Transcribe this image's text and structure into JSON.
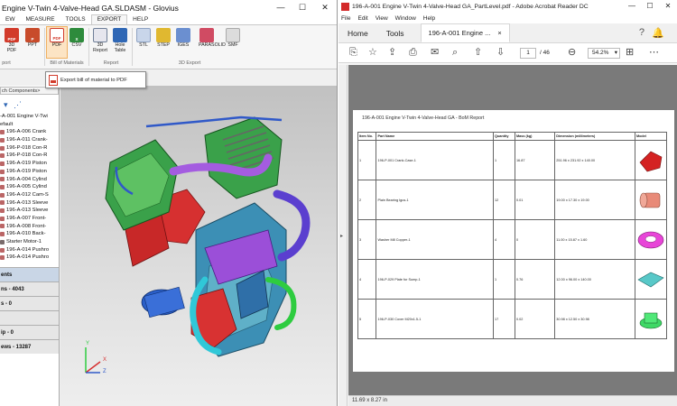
{
  "glovius": {
    "title": "Engine V-Twin 4-Valve-Head GA.SLDASM - Glovius",
    "window_controls": {
      "minimize": "—",
      "maximize": "☐",
      "close": "✕"
    },
    "menu": [
      "EW",
      "MEASURE",
      "TOOLS",
      "EXPORT",
      "HELP"
    ],
    "active_menu": "EXPORT",
    "ribbon": {
      "buttons": [
        {
          "label1": "3D",
          "label2": "PDF",
          "color": "#d23b2b"
        },
        {
          "label1": "PPT",
          "label2": "",
          "color": "#c84b2b"
        },
        {
          "label1": "PDF",
          "label2": "",
          "color": "#d23b2b"
        },
        {
          "label1": "CSV",
          "label2": "",
          "color": "#2e8b3c"
        },
        {
          "label1": "3D",
          "label2": "Report",
          "color": "#6f7f98"
        },
        {
          "label1": "Hole",
          "label2": "Table",
          "color": "#2f67b5"
        },
        {
          "label1": "STL",
          "label2": "",
          "color": "#8fa3c3"
        },
        {
          "label1": "STEP",
          "label2": "",
          "color": "#e0b830"
        },
        {
          "label1": "IGES",
          "label2": "",
          "color": "#6b8fd0"
        },
        {
          "label1": "PARASOLID",
          "label2": "",
          "color": "#d04b63"
        },
        {
          "label1": "SMF",
          "label2": "",
          "color": "#c8c8c8"
        }
      ],
      "groups": [
        "port",
        "Bill of Materials",
        "Report",
        "3D Export"
      ]
    },
    "tooltip": "Export bill of material to PDF",
    "search_placeholder": "ch Components>",
    "tree": [
      "-A-001 Engine V-Twi",
      "efault",
      "196-A-006 Crank",
      "196-A-011 Crank-",
      "196-P-018 Con-R",
      "196-P-018 Con-R",
      "196-A-019 Piston",
      "196-A-019 Piston",
      "196-A-004 Cylind",
      "196-A-005 Cylind",
      "196-A-012 Cam-S",
      "196-A-013 Sleeve",
      "196-A-013 Sleeve",
      "196-A-007 Front-",
      "196-A-008 Front-",
      "196-A-010 Back-",
      "Starter Motor-1",
      "196-A-014 Pushro",
      "196-A-014 Pushro"
    ],
    "panels": [
      {
        "label": "ents",
        "style": "hd"
      },
      {
        "label": "ns - 4043",
        "style": "lt"
      },
      {
        "label": "s - 0",
        "style": "lt"
      },
      {
        "label": "",
        "style": "lt"
      },
      {
        "label": "ip - 0",
        "style": "lt"
      },
      {
        "label": "ews - 13287",
        "style": "lt"
      }
    ],
    "axes": {
      "x": "X",
      "y": "Y",
      "z": "Z"
    }
  },
  "acrobat": {
    "title": "196-A-001 Engine V-Twin 4-Valve-Head GA_PartLevel.pdf - Adobe Acrobat Reader DC",
    "window_controls": {
      "minimize": "—",
      "maximize": "☐",
      "close": "✕"
    },
    "menu": [
      "File",
      "Edit",
      "View",
      "Window",
      "Help"
    ],
    "tabs": {
      "home": "Home",
      "tools": "Tools",
      "doc": "196-A-001 Engine ...",
      "close": "×"
    },
    "toolbar": {
      "page_current": "1",
      "page_total": "/ 46",
      "zoom": "54.2%"
    },
    "status": "11.69 x 8.27 in",
    "report": {
      "title": "196-A-001 Engine V-Twin 4-Valve-Head GA - BoM Report",
      "headers": [
        "Item No.",
        "Part Name",
        "Quantity",
        "Mass (kg)",
        "Dimension (millimeters)",
        "Model"
      ],
      "rows": [
        {
          "item": "1",
          "part": "196-P-001 Crank-Case-1",
          "qty": "1",
          "mass": "16.87",
          "dim": "251.96 x 231.92 x 140.00",
          "model_color": "#d42222"
        },
        {
          "item": "2",
          "part": "Plain Bearing Igus-1",
          "qty": "12",
          "mass": "0.01",
          "dim": "19.00 x 17.30 x 19.00",
          "model_color": "#e88a78"
        },
        {
          "item": "3",
          "part": "Washer M8 Copper-1",
          "qty": "4",
          "mass": "0",
          "dim": "11.00 x 15.87 x 1.60",
          "model_color": "#e845d8"
        },
        {
          "item": "4",
          "part": "196-P-029 Plate for Sump-1",
          "qty": "1",
          "mass": "0.76",
          "dim": "12.00 x 96.00 x 140.00",
          "model_color": "#58c8c8"
        },
        {
          "item": "5",
          "part": "196-P-030 Cover M20x1.5-1",
          "qty": "17",
          "mass": "0.02",
          "dim": "30.98 x 12.50 x 30.98",
          "model_color": "#3ed865"
        }
      ]
    }
  }
}
